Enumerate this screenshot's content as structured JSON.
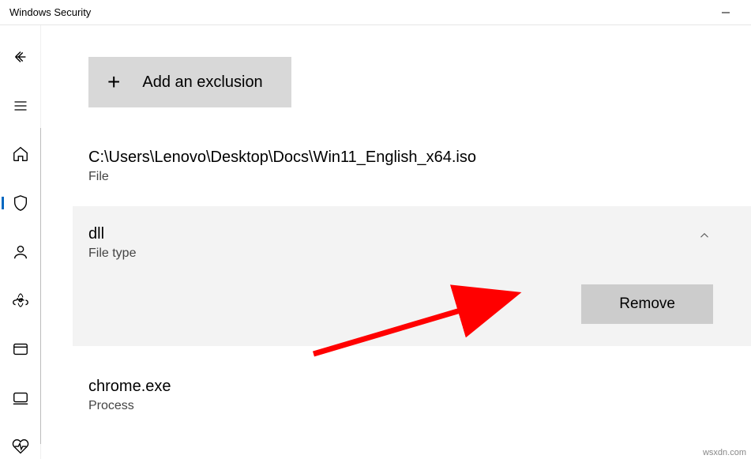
{
  "titlebar": {
    "title": "Windows Security"
  },
  "addButton": {
    "label": "Add an exclusion"
  },
  "exclusions": {
    "item0": {
      "path": "C:\\Users\\Lenovo\\Desktop\\Docs\\Win11_English_x64.iso",
      "type": "File"
    },
    "item1": {
      "path": "dll",
      "type": "File type",
      "removeLabel": "Remove"
    },
    "item2": {
      "path": "chrome.exe",
      "type": "Process"
    }
  },
  "watermark": "wsxdn.com"
}
